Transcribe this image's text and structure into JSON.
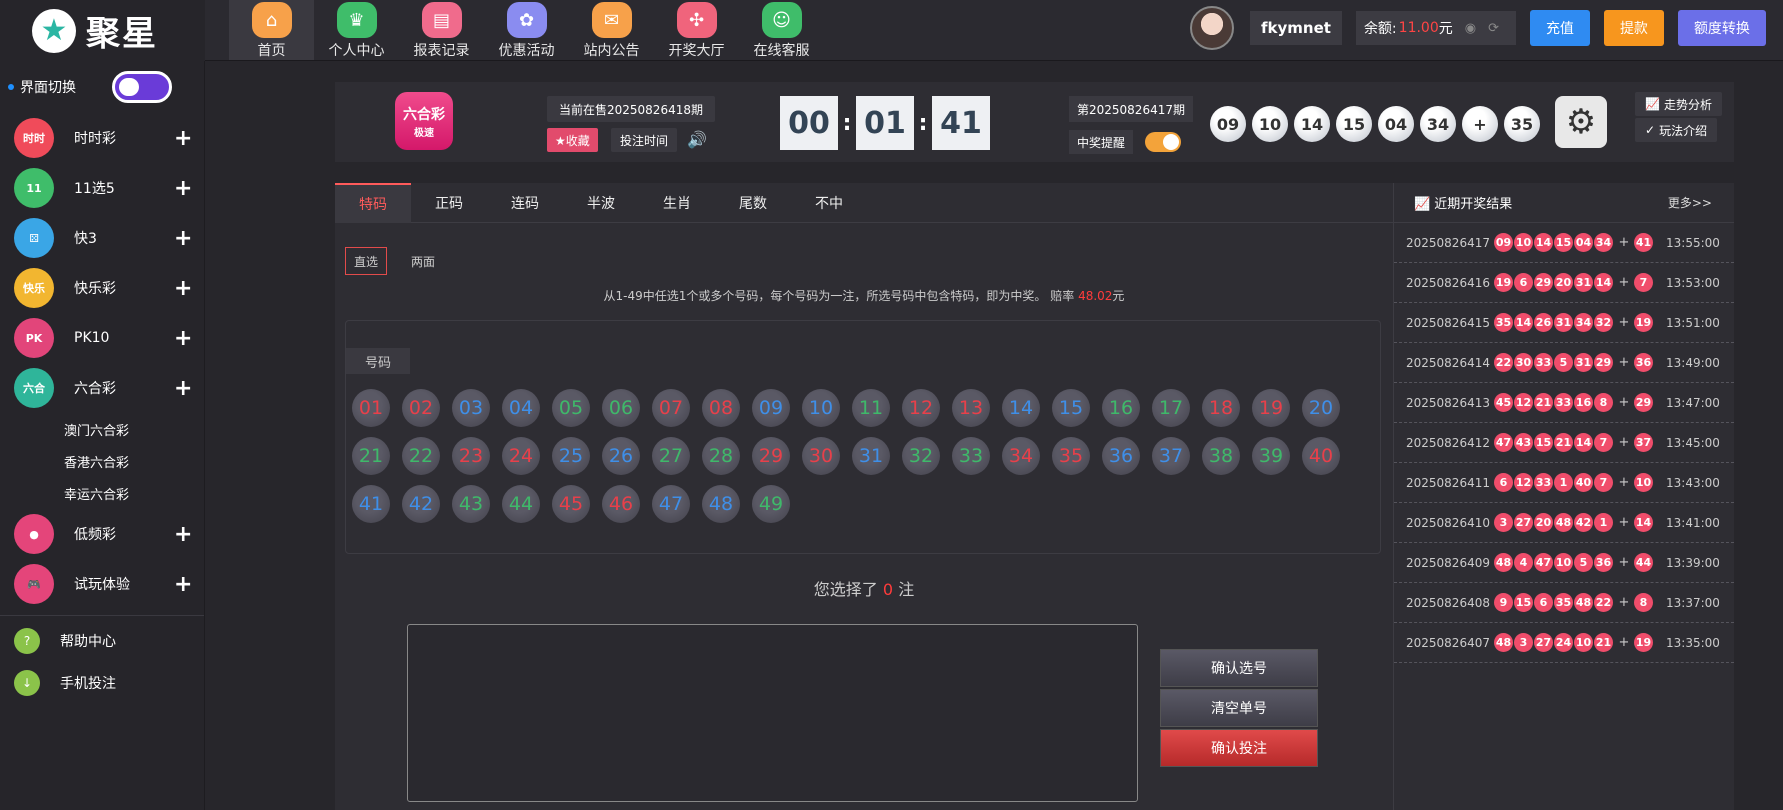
{
  "brand": {
    "name": "聚星"
  },
  "nav": [
    {
      "label": "首页",
      "color": "#f7a14a",
      "icon": "home-icon",
      "glyph": "⌂"
    },
    {
      "label": "个人中心",
      "color": "#3fbd6a",
      "icon": "crown-icon",
      "glyph": "♛"
    },
    {
      "label": "报表记录",
      "color": "#f06b8c",
      "icon": "report-icon",
      "glyph": "▤"
    },
    {
      "label": "优惠活动",
      "color": "#8a8cf0",
      "icon": "gift-icon",
      "glyph": "✿"
    },
    {
      "label": "站内公告",
      "color": "#f7a14a",
      "icon": "mail-icon",
      "glyph": "✉"
    },
    {
      "label": "开奖大厅",
      "color": "#f0647c",
      "icon": "grid-icon",
      "glyph": "✣"
    },
    {
      "label": "在线客服",
      "color": "#3fbd6a",
      "icon": "support-icon",
      "glyph": "☺"
    }
  ],
  "user": {
    "name": "fkymnet",
    "balance_label": "余额:",
    "balance": "11.00",
    "currency": "元",
    "buttons": [
      {
        "label": "充值",
        "color": "#2f8bf2"
      },
      {
        "label": "提款",
        "color": "#f7961e"
      },
      {
        "label": "额度转换",
        "color": "#6b6fe8"
      }
    ]
  },
  "sidebar": {
    "switch_label": "界面切换",
    "categories": [
      {
        "label": "时时彩",
        "color": "#f04b5a",
        "glyph": "时时"
      },
      {
        "label": "11选5",
        "color": "#3fbd6a",
        "glyph": "11"
      },
      {
        "label": "快3",
        "color": "#3aa6e6",
        "glyph": "⚄"
      },
      {
        "label": "快乐彩",
        "color": "#f2b630",
        "glyph": "快乐"
      },
      {
        "label": "PK10",
        "color": "#e2457a",
        "glyph": "PK"
      },
      {
        "label": "六合彩",
        "color": "#2fb59a",
        "glyph": "六合"
      }
    ],
    "subs": [
      "澳门六合彩",
      "香港六合彩",
      "幸运六合彩"
    ],
    "categories2": [
      {
        "label": "低频彩",
        "color": "#e4457a",
        "glyph": "●"
      },
      {
        "label": "试玩体验",
        "color": "#e4457a",
        "glyph": "🎮"
      }
    ],
    "help": [
      {
        "label": "帮助中心",
        "color": "#8bc34a",
        "glyph": "?"
      },
      {
        "label": "手机投注",
        "color": "#8bc34a",
        "glyph": "↓"
      }
    ]
  },
  "game": {
    "logo_text": "六合彩",
    "logo_sub": "极速",
    "current_issue": "当前在售20250826418期",
    "fav_label": "★收藏",
    "bettime_label": "投注时间",
    "timer": [
      "00",
      "01",
      "41"
    ],
    "last_issue": "第20250826417期",
    "alert_label": "中奖提醒",
    "result": [
      "09",
      "10",
      "14",
      "15",
      "04",
      "34"
    ],
    "result_plus": "+",
    "result_special": "35",
    "trend_label": "走势分析",
    "rules_label": "玩法介绍"
  },
  "bet": {
    "tabs": [
      "特码",
      "正码",
      "连码",
      "半波",
      "生肖",
      "尾数",
      "不中"
    ],
    "subtabs": [
      "直选",
      "两面"
    ],
    "desc_pre": "从1-49中任选1个或多个号码，每个号码为一注，所选号码中包含特码，即为中奖。 赔率",
    "odds": "48.02",
    "desc_post": "元",
    "panel_title": "号码",
    "numbers": [
      {
        "n": "01",
        "c": "red"
      },
      {
        "n": "02",
        "c": "red"
      },
      {
        "n": "03",
        "c": "blue"
      },
      {
        "n": "04",
        "c": "blue"
      },
      {
        "n": "05",
        "c": "green"
      },
      {
        "n": "06",
        "c": "green"
      },
      {
        "n": "07",
        "c": "red"
      },
      {
        "n": "08",
        "c": "red"
      },
      {
        "n": "09",
        "c": "blue"
      },
      {
        "n": "10",
        "c": "blue"
      },
      {
        "n": "11",
        "c": "green"
      },
      {
        "n": "12",
        "c": "red"
      },
      {
        "n": "13",
        "c": "red"
      },
      {
        "n": "14",
        "c": "blue"
      },
      {
        "n": "15",
        "c": "blue"
      },
      {
        "n": "16",
        "c": "green"
      },
      {
        "n": "17",
        "c": "green"
      },
      {
        "n": "18",
        "c": "red"
      },
      {
        "n": "19",
        "c": "red"
      },
      {
        "n": "20",
        "c": "blue"
      },
      {
        "n": "21",
        "c": "green"
      },
      {
        "n": "22",
        "c": "green"
      },
      {
        "n": "23",
        "c": "red"
      },
      {
        "n": "24",
        "c": "red"
      },
      {
        "n": "25",
        "c": "blue"
      },
      {
        "n": "26",
        "c": "blue"
      },
      {
        "n": "27",
        "c": "green"
      },
      {
        "n": "28",
        "c": "green"
      },
      {
        "n": "29",
        "c": "red"
      },
      {
        "n": "30",
        "c": "red"
      },
      {
        "n": "31",
        "c": "blue"
      },
      {
        "n": "32",
        "c": "green"
      },
      {
        "n": "33",
        "c": "green"
      },
      {
        "n": "34",
        "c": "red"
      },
      {
        "n": "35",
        "c": "red"
      },
      {
        "n": "36",
        "c": "blue"
      },
      {
        "n": "37",
        "c": "blue"
      },
      {
        "n": "38",
        "c": "green"
      },
      {
        "n": "39",
        "c": "green"
      },
      {
        "n": "40",
        "c": "red"
      },
      {
        "n": "41",
        "c": "blue"
      },
      {
        "n": "42",
        "c": "blue"
      },
      {
        "n": "43",
        "c": "green"
      },
      {
        "n": "44",
        "c": "green"
      },
      {
        "n": "45",
        "c": "red"
      },
      {
        "n": "46",
        "c": "red"
      },
      {
        "n": "47",
        "c": "blue"
      },
      {
        "n": "48",
        "c": "blue"
      },
      {
        "n": "49",
        "c": "green"
      }
    ],
    "sel_pre": "您选择了",
    "sel_count": "0",
    "sel_post": "注",
    "confirm_label": "确认选号",
    "clear_label": "清空单号",
    "submit_label": "确认投注"
  },
  "recent": {
    "title": "近期开奖结果",
    "more": "更多>>",
    "rows": [
      {
        "issue": "20250826417",
        "balls": [
          "09",
          "10",
          "14",
          "15",
          "04",
          "34"
        ],
        "special": "41",
        "time": "13:55:00"
      },
      {
        "issue": "20250826416",
        "balls": [
          "19",
          "6",
          "29",
          "20",
          "31",
          "14"
        ],
        "special": "7",
        "time": "13:53:00"
      },
      {
        "issue": "20250826415",
        "balls": [
          "35",
          "14",
          "26",
          "31",
          "34",
          "32"
        ],
        "special": "19",
        "time": "13:51:00"
      },
      {
        "issue": "20250826414",
        "balls": [
          "22",
          "30",
          "33",
          "5",
          "31",
          "29"
        ],
        "special": "36",
        "time": "13:49:00"
      },
      {
        "issue": "20250826413",
        "balls": [
          "45",
          "12",
          "21",
          "33",
          "16",
          "8"
        ],
        "special": "29",
        "time": "13:47:00"
      },
      {
        "issue": "20250826412",
        "balls": [
          "47",
          "43",
          "15",
          "21",
          "14",
          "7"
        ],
        "special": "37",
        "time": "13:45:00"
      },
      {
        "issue": "20250826411",
        "balls": [
          "6",
          "12",
          "33",
          "1",
          "40",
          "7"
        ],
        "special": "10",
        "time": "13:43:00"
      },
      {
        "issue": "20250826410",
        "balls": [
          "3",
          "27",
          "20",
          "48",
          "42",
          "1"
        ],
        "special": "14",
        "time": "13:41:00"
      },
      {
        "issue": "20250826409",
        "balls": [
          "48",
          "4",
          "47",
          "10",
          "5",
          "36"
        ],
        "special": "44",
        "time": "13:39:00"
      },
      {
        "issue": "20250826408",
        "balls": [
          "9",
          "15",
          "6",
          "35",
          "48",
          "22"
        ],
        "special": "8",
        "time": "13:37:00"
      },
      {
        "issue": "20250826407",
        "balls": [
          "48",
          "3",
          "27",
          "24",
          "10",
          "21"
        ],
        "special": "19",
        "time": "13:35:00"
      }
    ]
  }
}
